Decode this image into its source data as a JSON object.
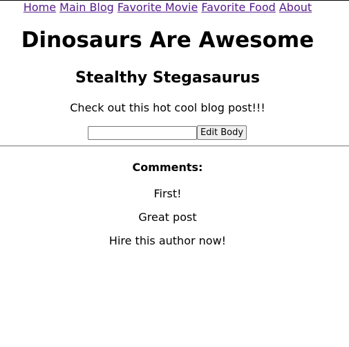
{
  "nav": {
    "links": [
      "Home",
      "Main Blog",
      "Favorite Movie",
      "Favorite Food",
      "About"
    ]
  },
  "site": {
    "title": "Dinosaurs Are Awesome"
  },
  "post": {
    "title": "Stealthy Stegasaurus",
    "body": "Check out this hot cool blog post!!!"
  },
  "edit": {
    "input_value": "",
    "button_label": "Edit Body"
  },
  "comments": {
    "heading": "Comments:",
    "items": [
      "First!",
      "Great post",
      "Hire this author now!"
    ]
  },
  "colors": {
    "link": "#551a8b",
    "divider": "#8a8a8a"
  }
}
